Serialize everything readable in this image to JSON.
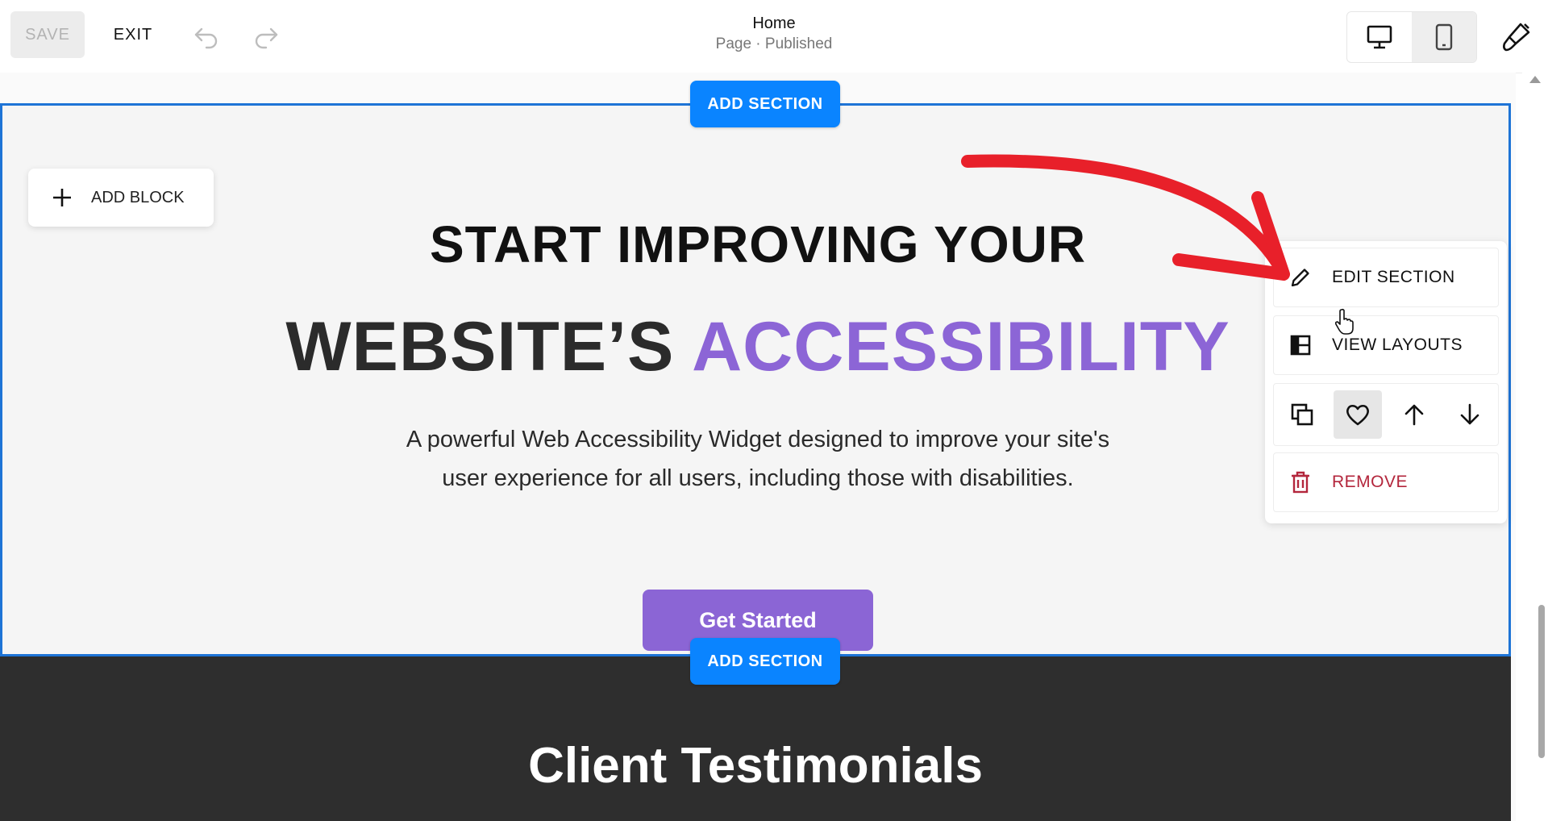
{
  "toolbar": {
    "save_label": "SAVE",
    "exit_label": "EXIT",
    "page_name": "Home",
    "page_status": "Page · Published"
  },
  "canvas": {
    "add_section_label": "ADD SECTION",
    "add_block_label": "ADD BLOCK",
    "hero": {
      "heading_line1": "START IMPROVING YOUR",
      "heading_line2_part1": "WEBSITE’S ",
      "heading_line2_accent": "ACCESSIBILITY",
      "description": "A powerful Web Accessibility Widget designed to improve your site's user experience for all users, including those with disabilities.",
      "cta_label": "Get Started",
      "accent_color": "#8c65d6"
    },
    "testimonials_title": "Client Testimonials"
  },
  "section_menu": {
    "edit_section": "EDIT SECTION",
    "view_layouts": "VIEW LAYOUTS",
    "remove": "REMOVE",
    "icons": [
      "duplicate-icon",
      "heart-icon",
      "arrow-up-icon",
      "arrow-down-icon"
    ]
  },
  "colors": {
    "primary_blue": "#0a84ff",
    "selection_border": "#1e74d6",
    "remove_red": "#b3263c",
    "annotation_red": "#e8202a"
  }
}
